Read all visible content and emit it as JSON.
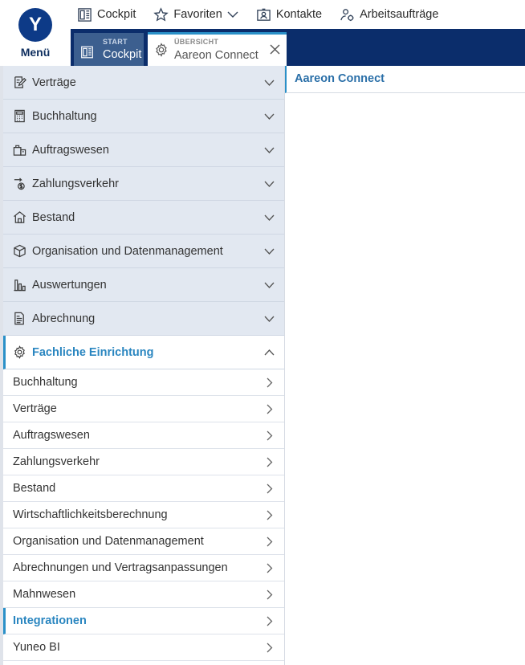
{
  "app": {
    "logo_letter": "Y",
    "menu_label": "Menü"
  },
  "quicklinks": [
    {
      "label": "Cockpit",
      "icon": "cockpit-icon"
    },
    {
      "label": "Favoriten",
      "icon": "star-icon"
    },
    {
      "label": "Kontakte",
      "icon": "contact-card-icon"
    },
    {
      "label": "Arbeitsaufträge",
      "icon": "user-task-icon"
    }
  ],
  "tabs": [
    {
      "overline": "START",
      "label": "Cockpit",
      "icon": "cockpit-icon"
    },
    {
      "overline": "ÜBERSICHT",
      "label": "Aareon Connect",
      "icon": "gear-icon",
      "active": true
    }
  ],
  "sidebar": {
    "groups": [
      {
        "label": "Verträge",
        "icon": "contract-edit-icon"
      },
      {
        "label": "Buchhaltung",
        "icon": "calculator-icon"
      },
      {
        "label": "Auftragswesen",
        "icon": "orders-icon"
      },
      {
        "label": "Zahlungsverkehr",
        "icon": "payment-icon"
      },
      {
        "label": "Bestand",
        "icon": "house-icon"
      },
      {
        "label": "Organisation und Datenmanagement",
        "icon": "cube-icon"
      },
      {
        "label": "Auswertungen",
        "icon": "bar-chart-icon"
      },
      {
        "label": "Abrechnung",
        "icon": "billing-doc-icon"
      },
      {
        "label": "Fachliche Einrichtung",
        "icon": "gear-icon",
        "expanded": true
      }
    ],
    "subitems": [
      {
        "label": "Buchhaltung"
      },
      {
        "label": "Verträge"
      },
      {
        "label": "Auftragswesen"
      },
      {
        "label": "Zahlungsverkehr"
      },
      {
        "label": "Bestand"
      },
      {
        "label": "Wirtschaftlichkeitsberechnung"
      },
      {
        "label": "Organisation und Datenmanagement"
      },
      {
        "label": "Abrechnungen und Vertragsanpassungen"
      },
      {
        "label": "Mahnwesen"
      },
      {
        "label": "Integrationen",
        "active": true
      },
      {
        "label": "Yuneo BI"
      }
    ]
  },
  "content": {
    "title": "Aareon Connect"
  },
  "colors": {
    "brand_navy": "#0b2d6b",
    "accent_blue": "#2a90c8",
    "group_bg": "#e2e8f1"
  }
}
